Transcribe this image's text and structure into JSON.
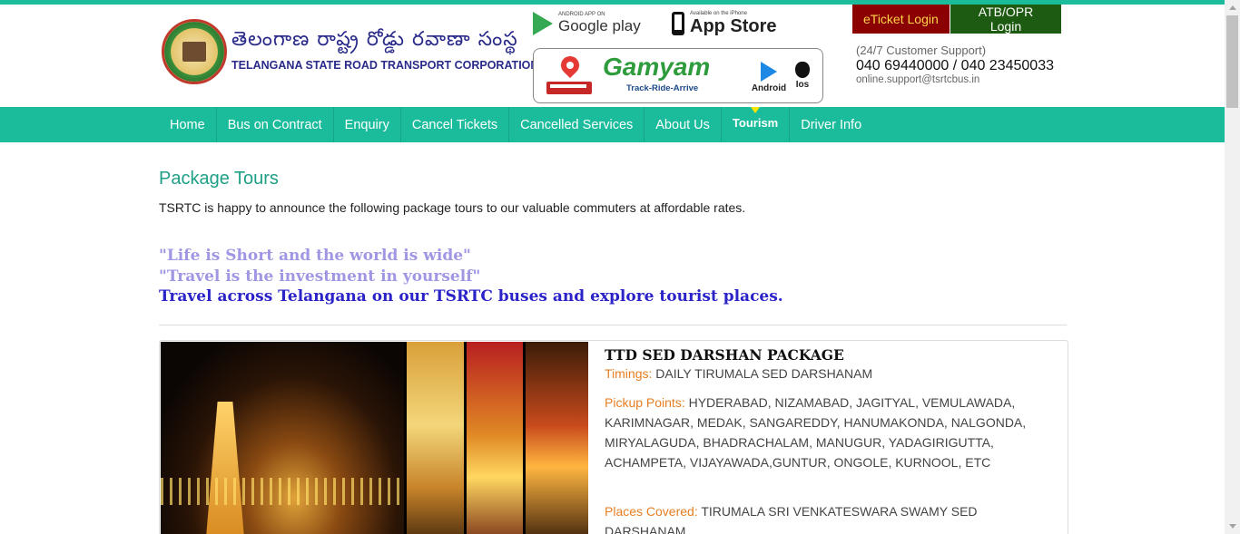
{
  "header": {
    "brand_telugu": "తెలంగాణ  రాష్ట్ర రోడ్డు రవాణా సంస్థ",
    "brand_english": "TELANGANA STATE ROAD TRANSPORT CORPORATION",
    "google_play": {
      "small": "ANDROID APP ON",
      "big": "Google play"
    },
    "app_store": {
      "small": "Available on the iPhone",
      "big": "App Store"
    },
    "gamyam": {
      "title": "Gamyam",
      "tagline": "Track-Ride-Arrive",
      "android": "Android",
      "ios": "Ios"
    },
    "eticket_login": "eTicket Login",
    "atb_login": "ATB/OPR Login",
    "support_label": "(24/7 Customer Support)",
    "support_phone": "040 69440000 / 040 23450033",
    "support_email": "online.support@tsrtcbus.in"
  },
  "nav": {
    "items": [
      {
        "label": "Home"
      },
      {
        "label": "Bus on Contract"
      },
      {
        "label": "Enquiry"
      },
      {
        "label": "Cancel Tickets"
      },
      {
        "label": "Cancelled Services"
      },
      {
        "label": "About Us"
      },
      {
        "label": "Tourism"
      },
      {
        "label": "Driver Info"
      }
    ],
    "active": "Tourism"
  },
  "main": {
    "title": "Package Tours",
    "intro": "TSRTC is happy to announce the following package tours to our valuable commuters at affordable rates.",
    "quotes": [
      "\"Life is Short and the world is wide\"",
      "\"Travel is the investment in yourself\"",
      "Travel across Telangana on our TSRTC buses and explore tourist places."
    ],
    "package": {
      "title": "TTD SED DARSHAN PACKAGE",
      "timings_label": "Timings:",
      "timings": "DAILY TIRUMALA SED DARSHANAM",
      "pickup_label": "Pickup Points:",
      "pickup": "HYDERABAD, NIZAMABAD, JAGITYAL, VEMULAWADA, KARIMNAGAR, MEDAK, SANGAREDDY, HANUMAKONDA, NALGONDA, MIRYALAGUDA, BHADRACHALAM, MANUGUR, YADAGIRIGUTTA, ACHAMPETA, VIJAYAWADA,GUNTUR, ONGOLE, KURNOOL, ETC",
      "places_label": "Places Covered:",
      "places": "TIRUMALA SRI VENKATESWARA SWAMY SED DARSHANAM"
    }
  },
  "colors": {
    "accent": "#1abc9c",
    "title_green": "#1f9f86",
    "label_orange": "#e67e22",
    "quote_light": "#9f97e3",
    "quote_dark": "#2b23c8",
    "eticket_bg": "#8b0000",
    "atb_bg": "#1e5b12"
  }
}
